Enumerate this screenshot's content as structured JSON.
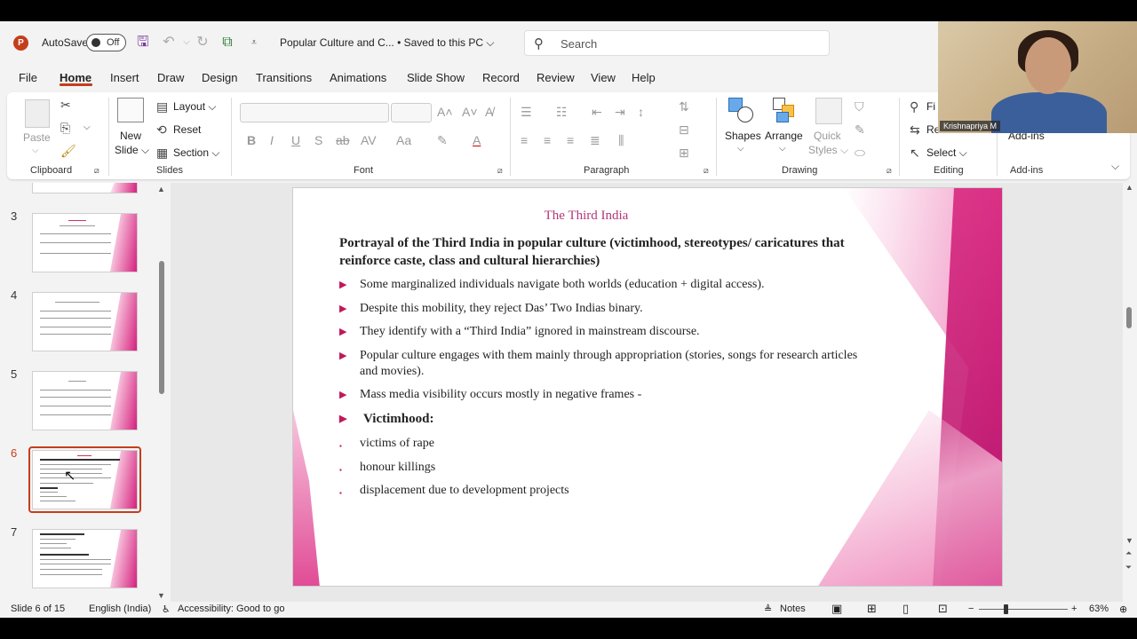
{
  "titlebar": {
    "app_logo": "P",
    "autosave_label": "AutoSave",
    "autosave_state": "Off",
    "doc_title": "Popular Culture and C... • Saved to this PC ⌵",
    "search_placeholder": "Search"
  },
  "webcam": {
    "name": "Krishnapriya M"
  },
  "tabs": [
    "File",
    "Home",
    "Insert",
    "Draw",
    "Design",
    "Transitions",
    "Animations",
    "Slide Show",
    "Record",
    "Review",
    "View",
    "Help"
  ],
  "ribbon": {
    "clipboard": {
      "paste": "Paste",
      "label": "Clipboard"
    },
    "slides": {
      "new_slide": "New",
      "new_slide2": "Slide ⌵",
      "layout": "Layout ⌵",
      "reset": "Reset",
      "section": "Section ⌵",
      "label": "Slides"
    },
    "font": {
      "label": "Font"
    },
    "paragraph": {
      "label": "Paragraph"
    },
    "drawing": {
      "shapes": "Shapes",
      "arrange": "Arrange",
      "quick_styles": "Quick",
      "quick_styles2": "Styles ⌵",
      "label": "Drawing"
    },
    "editing": {
      "find": "Fi",
      "replace": "Re",
      "select": "Select ⌵",
      "label": "Editing"
    },
    "addins": {
      "addins": "Add-ins",
      "label": "Add-ins"
    }
  },
  "thumbnails": [
    {
      "num": "3"
    },
    {
      "num": "4"
    },
    {
      "num": "5"
    },
    {
      "num": "6"
    },
    {
      "num": "7"
    }
  ],
  "slide": {
    "title": "The Third India",
    "heading": "Portrayal of the Third India in popular culture (victimhood, stereotypes/ caricatures that reinforce caste, class and cultural hierarchies)",
    "bullets": [
      "Some marginalized individuals navigate both worlds (education + digital access).",
      "Despite this mobility, they reject Das’ Two Indias binary.",
      "They identify with a “Third India” ignored in mainstream discourse.",
      "Popular culture engages with them mainly through appropriation (stories, songs for research articles and movies).",
      "Mass media visibility occurs mostly in negative frames -",
      "Victimhood:"
    ],
    "sub_bullets": [
      "victims of rape",
      "honour killings",
      "displacement due to development projects"
    ],
    "bullet_marker": "▶",
    "sub_marker": "▪"
  },
  "statusbar": {
    "slide_info": "Slide 6 of 15",
    "language": "English (India)",
    "accessibility": "Accessibility: Good to go",
    "notes": "Notes",
    "zoom": "63%"
  }
}
